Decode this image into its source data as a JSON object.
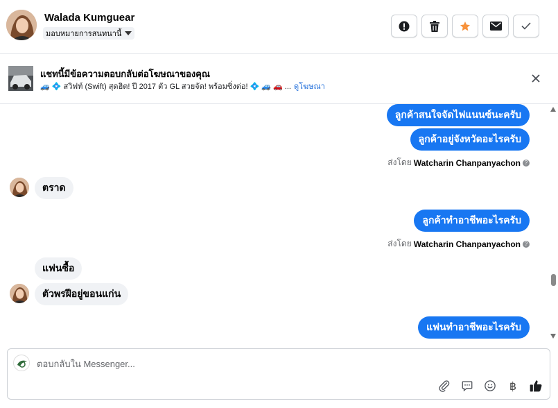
{
  "header": {
    "user_name": "Walada Kumguear",
    "assign_label": "มอบหมายการสนทนานี้",
    "actions": [
      {
        "name": "report-button",
        "icon": "alert-circle-icon"
      },
      {
        "name": "delete-button",
        "icon": "trash-icon"
      },
      {
        "name": "star-button",
        "icon": "star-icon"
      },
      {
        "name": "mark-unread-button",
        "icon": "envelope-icon"
      },
      {
        "name": "mark-done-button",
        "icon": "checkmark-icon"
      }
    ]
  },
  "ad_banner": {
    "title": "แชทนี้มีข้อความตอบกลับต่อโฆษณาของคุณ",
    "text": "🚙 💠 สวิฟท์ (Swift) สุดฮิต! ปี 2017 ตัว GL สวยจัด! พร้อมซิ่งต่อ! 💠 🚙 🚗 ...",
    "link": "ดูโฆษณา"
  },
  "messages": [
    {
      "dir": "out",
      "text": "ลูกค้าสนใจจัดไฟแนนซ์นะครับ"
    },
    {
      "dir": "out",
      "text": "ลูกค้าอยู่จังหวัดอะไรครับ"
    },
    {
      "dir": "meta",
      "prefix": "ส่งโดย",
      "author": "Watcharin Chanpanyachon"
    },
    {
      "dir": "in",
      "text": "ตราด"
    },
    {
      "dir": "out",
      "text": "ลูกค้าทำอาชีพอะไรครับ"
    },
    {
      "dir": "meta",
      "prefix": "ส่งโดย",
      "author": "Watcharin Chanpanyachon"
    },
    {
      "dir": "in",
      "text": "แฟนซื้อ"
    },
    {
      "dir": "in",
      "text": "ตัวพรฝีอยู่ขอนแก่น"
    },
    {
      "dir": "out",
      "text": "แฟนทำอาชีพอะไรครับ"
    }
  ],
  "composer": {
    "placeholder": "ตอบกลับใน Messenger...",
    "tools": [
      "attachment-icon",
      "saved-reply-icon",
      "emoji-icon",
      "baht-icon",
      "thumbs-up-icon"
    ],
    "baht_symbol": "฿"
  },
  "colors": {
    "accent": "#1877f2",
    "star": "#f7923b"
  }
}
